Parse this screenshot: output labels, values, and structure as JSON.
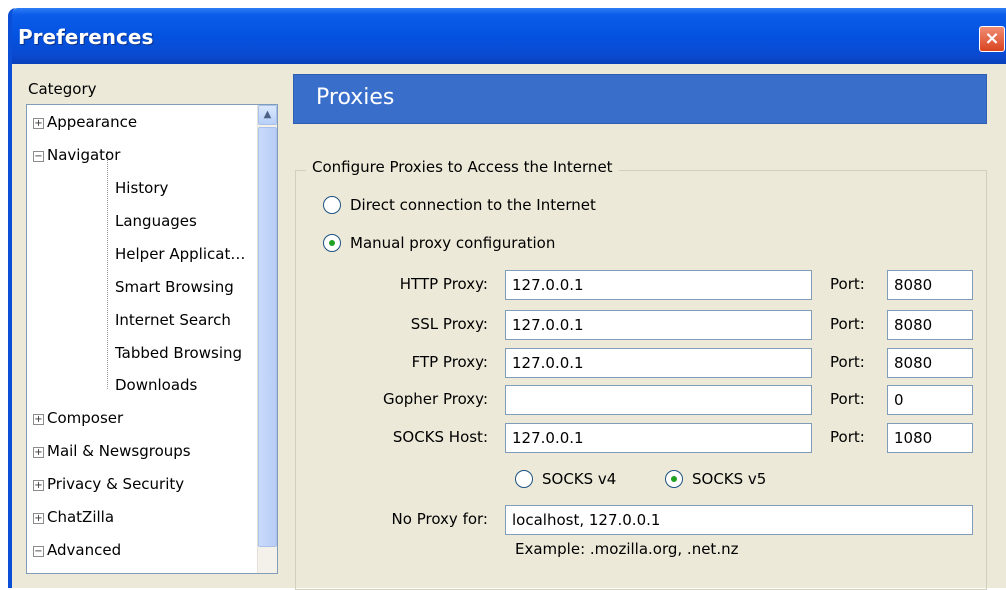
{
  "window": {
    "title": "Preferences",
    "close_glyph": "×"
  },
  "category": {
    "label": "Category",
    "items": [
      {
        "label": "Appearance",
        "expander": "+"
      },
      {
        "label": "Navigator",
        "expander": "−"
      },
      {
        "label": "History"
      },
      {
        "label": "Languages"
      },
      {
        "label": "Helper Applicat…"
      },
      {
        "label": "Smart Browsing"
      },
      {
        "label": "Internet Search"
      },
      {
        "label": "Tabbed Browsing"
      },
      {
        "label": "Downloads"
      },
      {
        "label": "Composer",
        "expander": "+"
      },
      {
        "label": "Mail & Newsgroups",
        "expander": "+"
      },
      {
        "label": "Privacy & Security",
        "expander": "+"
      },
      {
        "label": "ChatZilla",
        "expander": "+"
      },
      {
        "label": "Advanced",
        "expander": "−"
      }
    ]
  },
  "panel": {
    "header": "Proxies",
    "group_title": "Configure Proxies to Access the Internet",
    "direct_label": "Direct connection to the Internet",
    "manual_label": "Manual proxy configuration",
    "selected_mode": "manual",
    "proxies": [
      {
        "label": "HTTP Proxy:",
        "value": "127.0.0.1",
        "port_label": "Port:",
        "port": "8080"
      },
      {
        "label": "SSL Proxy:",
        "value": "127.0.0.1",
        "port_label": "Port:",
        "port": "8080"
      },
      {
        "label": "FTP Proxy:",
        "value": "127.0.0.1",
        "port_label": "Port:",
        "port": "8080"
      },
      {
        "label": "Gopher Proxy:",
        "value": "",
        "port_label": "Port:",
        "port": "0"
      },
      {
        "label": "SOCKS Host:",
        "value": "127.0.0.1",
        "port_label": "Port:",
        "port": "1080"
      }
    ],
    "socks_v4_label": "SOCKS v4",
    "socks_v5_label": "SOCKS v5",
    "socks_selected": "v5",
    "no_proxy_label": "No Proxy for:",
    "no_proxy_value": "localhost, 127.0.0.1",
    "example": "Example: .mozilla.org, .net.nz"
  },
  "colors": {
    "titlebar": "#0452e0",
    "header_bar": "#3a6ecb",
    "dialog_bg": "#ece9d8",
    "radio_check": "#21a121"
  }
}
